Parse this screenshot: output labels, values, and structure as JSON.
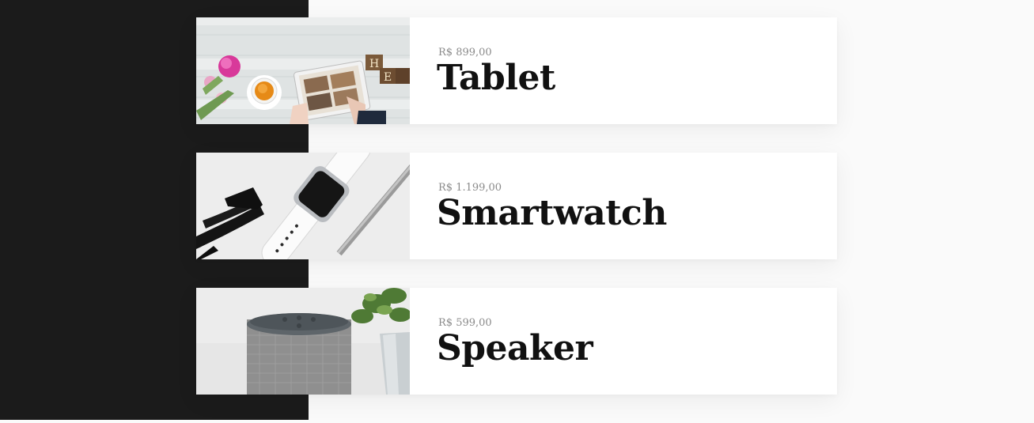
{
  "products": [
    {
      "price": "R$ 899,00",
      "name": "Tablet",
      "image": "tablet-photo"
    },
    {
      "price": "R$ 1.199,00",
      "name": "Smartwatch",
      "image": "smartwatch-photo"
    },
    {
      "price": "R$ 599,00",
      "name": "Speaker",
      "image": "speaker-photo"
    }
  ],
  "colors": {
    "dark_panel": "#1b1b1b",
    "page_background": "#fafafa",
    "card_background": "#ffffff",
    "price_text": "#8a8a8a",
    "name_text": "#111111"
  }
}
